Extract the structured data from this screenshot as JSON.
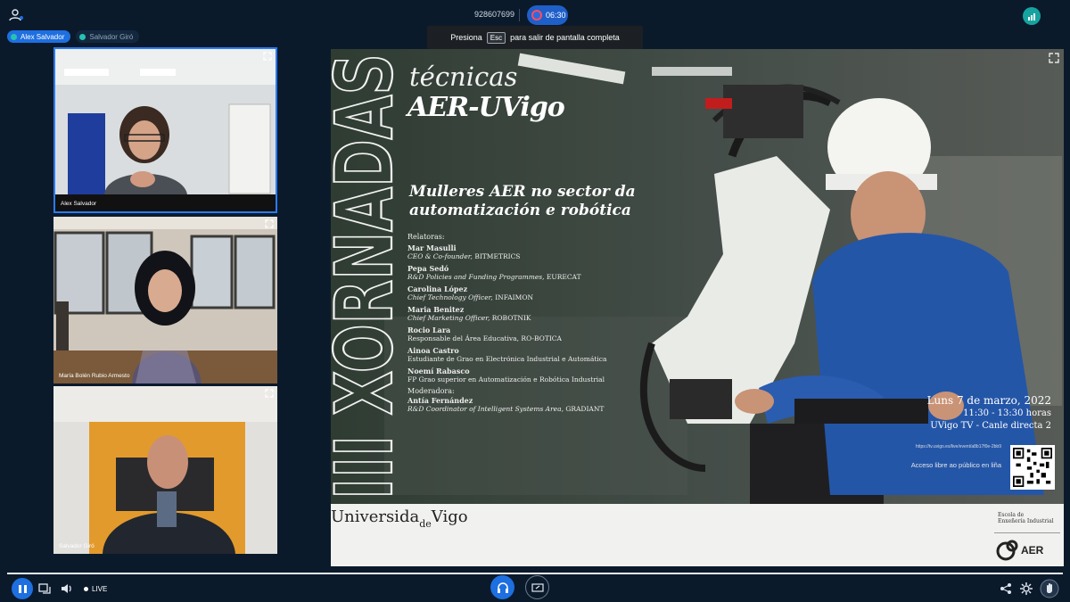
{
  "header": {
    "meeting_id": "928607699",
    "record_time": "06:30",
    "participant_chips": [
      {
        "label": "Alex Salvador"
      },
      {
        "label": "Salvador Giró"
      }
    ]
  },
  "fullscreen_toast": {
    "before": "Presiona",
    "key": "Esc",
    "after": "para salir de pantalla completa"
  },
  "participants": [
    {
      "name": "Alex Salvador"
    },
    {
      "name": "María Bolén Rubio Armesto"
    },
    {
      "name": "Salvador Giró"
    }
  ],
  "slide": {
    "vertical_title": "III XORNADAS",
    "title_line1": "técnicas",
    "title_line2": "AER-UVigo",
    "talk_line1": "Mulleres AER no sector da",
    "talk_line2": "automatización e robótica",
    "relatoras_label": "Relatoras:",
    "speakers": [
      {
        "name": "Mar Masulli",
        "role": "CEO & Co-founder,",
        "org": "BITMETRICS"
      },
      {
        "name": "Pepa Sedó",
        "role": "R&D Policies and Funding Programmes,",
        "org": "EURECAT"
      },
      {
        "name": "Carolina López",
        "role": "Chief Technology Officer,",
        "org": "INFAIMON"
      },
      {
        "name": "Maria Benitez",
        "role": "Chief Marketing Officer,",
        "org": "ROBOTNIK"
      },
      {
        "name": "Rocio Lara",
        "role": "Responsable del Área Educativa,",
        "org": "RO-BOTICA"
      },
      {
        "name": "Ainoa Castro",
        "role": "Estudiante de Grao en Electrónica Industrial e Automática",
        "org": ""
      },
      {
        "name": "Noemí Rabasco",
        "role": "FP Grao superior en Automatización e Robótica Industrial",
        "org": ""
      }
    ],
    "moderadora_label": "Moderadora:",
    "moderator": {
      "name": "Antía Fernández",
      "role": "R&D Coordinator of Intelligent Systems Area,",
      "org": "GRADIANT"
    },
    "event_date": "Luns 7 de marzo, 2022",
    "event_time": "11:30 - 13:30 horas",
    "event_channel": "UVigo TV - Canle directa 2",
    "event_url": "https://tv.uvigo.es/live/event/a8b17f0e-2bb9",
    "public_access": "Acceso libre ao público en liña",
    "university": "Universida",
    "university_de": "de",
    "university_end": "Vigo",
    "school_line1": "Escola de",
    "school_line2": "Enxeñería Industrial",
    "aer_logo_text": "AER"
  },
  "footer": {
    "live_label": "LIVE"
  },
  "colors": {
    "accent": "#1e6fe0",
    "teal": "#16a3a0",
    "background": "#0b1a2b"
  }
}
